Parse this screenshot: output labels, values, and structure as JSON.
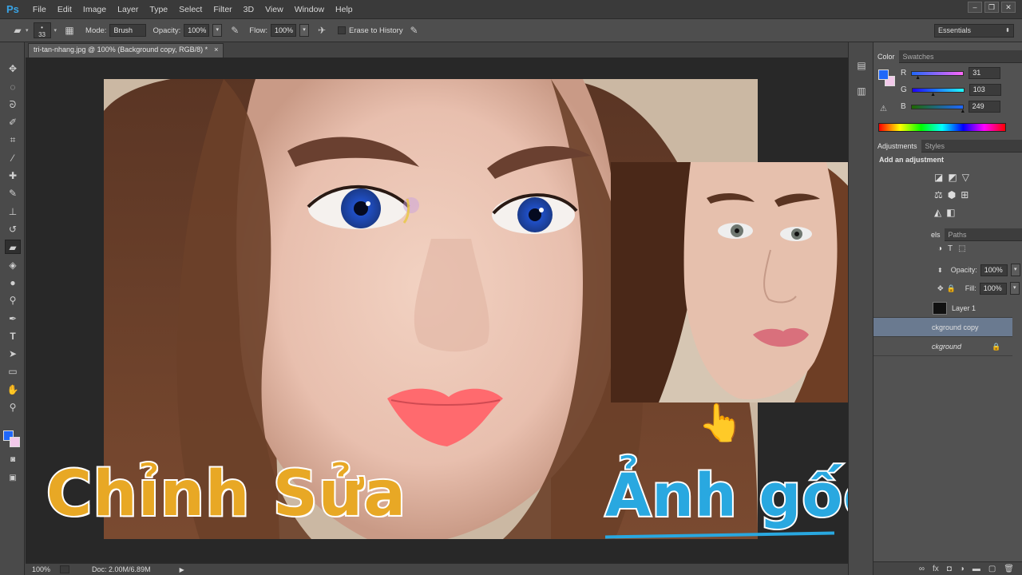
{
  "app": {
    "logo": "Ps"
  },
  "menu": [
    "File",
    "Edit",
    "Image",
    "Layer",
    "Type",
    "Select",
    "Filter",
    "3D",
    "View",
    "Window",
    "Help"
  ],
  "options": {
    "brush_size": "33",
    "mode_label": "Mode:",
    "mode_value": "Brush",
    "opacity_label": "Opacity:",
    "opacity_value": "100%",
    "flow_label": "Flow:",
    "flow_value": "100%",
    "erase_to_history": "Erase to History",
    "workspace": "Essentials"
  },
  "document": {
    "tab_title": "tri-tan-nhang.jpg @ 100% (Background copy, RGB/8) *",
    "close": "×"
  },
  "status": {
    "zoom": "100%",
    "doc": "Doc: 2.00M/6.89M"
  },
  "color_panel": {
    "tabs": [
      "Color",
      "Swatches"
    ],
    "r_label": "R",
    "g_label": "G",
    "b_label": "B",
    "r": "31",
    "g": "103",
    "b": "249",
    "r_level": 0.12,
    "g_level": 0.4,
    "b_level": 0.98
  },
  "adjustments": {
    "tabs": [
      "Adjustments",
      "Styles"
    ],
    "title": "Add an adjustment"
  },
  "layers_panel": {
    "tabs_partial": "els",
    "paths": "Paths",
    "opacity_label": "Opacity:",
    "opacity_value": "100%",
    "fill_label": "Fill:",
    "fill_value": "100%",
    "layers": [
      {
        "name": "Layer 1"
      },
      {
        "name": "ckground copy"
      },
      {
        "name": "ckground"
      }
    ]
  },
  "overlay_text": {
    "left": "Chỉnh Sửa",
    "right": "Ảnh gốc"
  },
  "colors": {
    "foreground": "#1f67f9",
    "accent_blue": "#29a8e0",
    "accent_gold": "#e8a825"
  }
}
